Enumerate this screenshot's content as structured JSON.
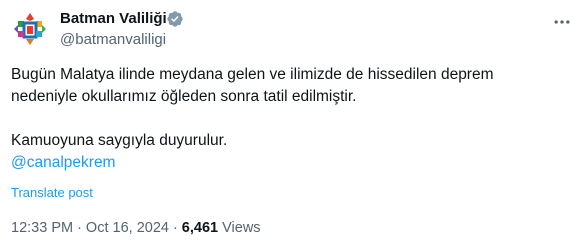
{
  "author": {
    "name": "Batman Valiliği",
    "handle": "@batmanvaliligi",
    "verified": true,
    "verified_color": "#829aab"
  },
  "tweet": {
    "line1": "Bugün Malatya ilinde meydana gelen ve ilimizde de hissedilen deprem",
    "line2": "nedeniyle okullarımız öğleden sonra tatil edilmiştir.",
    "line3": "Kamuoyuna saygıyla duyurulur.",
    "mention": "@canalpekrem"
  },
  "translate_label": "Translate post",
  "meta": {
    "time": "12:33 PM",
    "separator": "·",
    "date": "Oct 16, 2024",
    "views_count": "6,461",
    "views_label": "Views"
  },
  "colors": {
    "link": "#1d9bf0",
    "secondary_text": "#536471",
    "primary_text": "#0f1419"
  },
  "icons": {
    "avatar": "batman-governorship-logo",
    "verified": "verified-badge-icon",
    "more": "more-options-icon"
  }
}
